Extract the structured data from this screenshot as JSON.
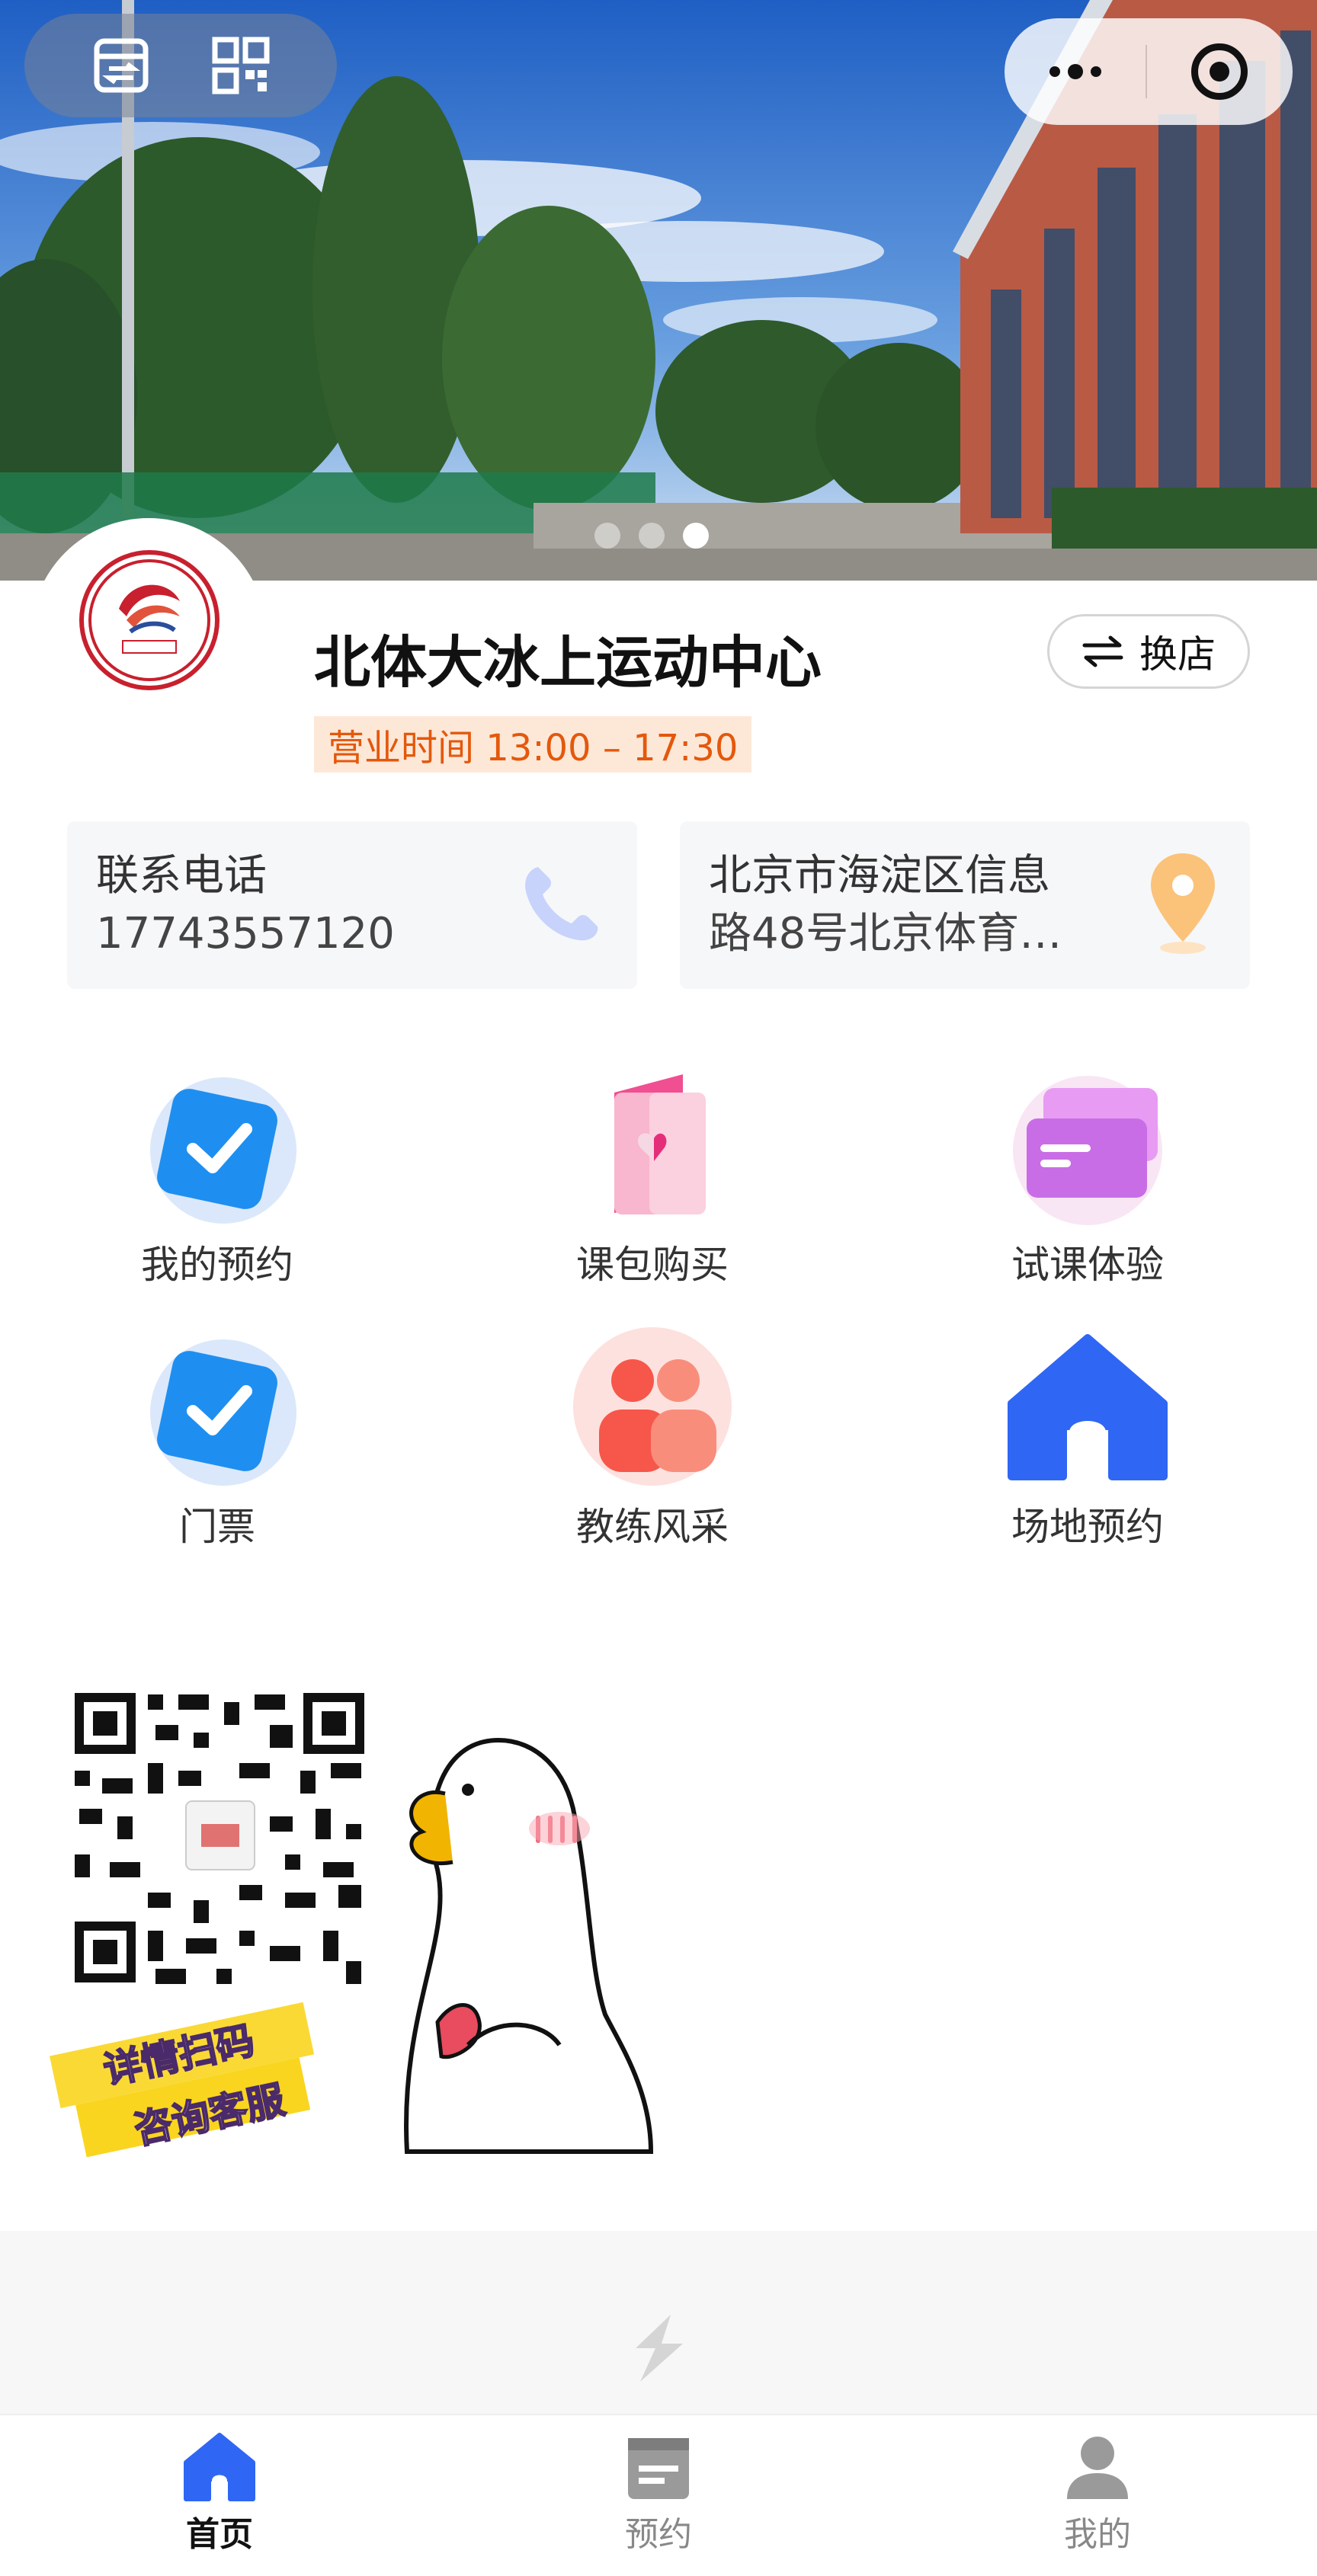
{
  "store": {
    "name": "北体大冰上运动中心",
    "switch_label": "换店",
    "hours": "营业时间 13:00 – 17:30"
  },
  "contact": {
    "phone_label": "联系电话",
    "phone_value": "17743557120",
    "address_line1": "北京市海淀区信息",
    "address_line2": "路48号北京体育…"
  },
  "menu": [
    {
      "label": "我的预约",
      "icon": "check-badge-icon"
    },
    {
      "label": "课包购买",
      "icon": "booklet-heart-icon"
    },
    {
      "label": "试课体验",
      "icon": "cards-icon"
    },
    {
      "label": "门票",
      "icon": "check-badge-icon"
    },
    {
      "label": "教练风采",
      "icon": "people-icon"
    },
    {
      "label": "场地预约",
      "icon": "home-icon"
    }
  ],
  "promo": {
    "line1": "详情扫码",
    "line2": "咨询客服"
  },
  "tabs": [
    {
      "label": "首页",
      "active": true
    },
    {
      "label": "预约",
      "active": false
    },
    {
      "label": "我的",
      "active": false
    }
  ],
  "colors": {
    "accent_blue": "#3b6cf6",
    "hours_text": "#e4580c",
    "hours_bg": "#fde8d8",
    "pink": "#f06aa0",
    "purple": "#c46de8"
  }
}
